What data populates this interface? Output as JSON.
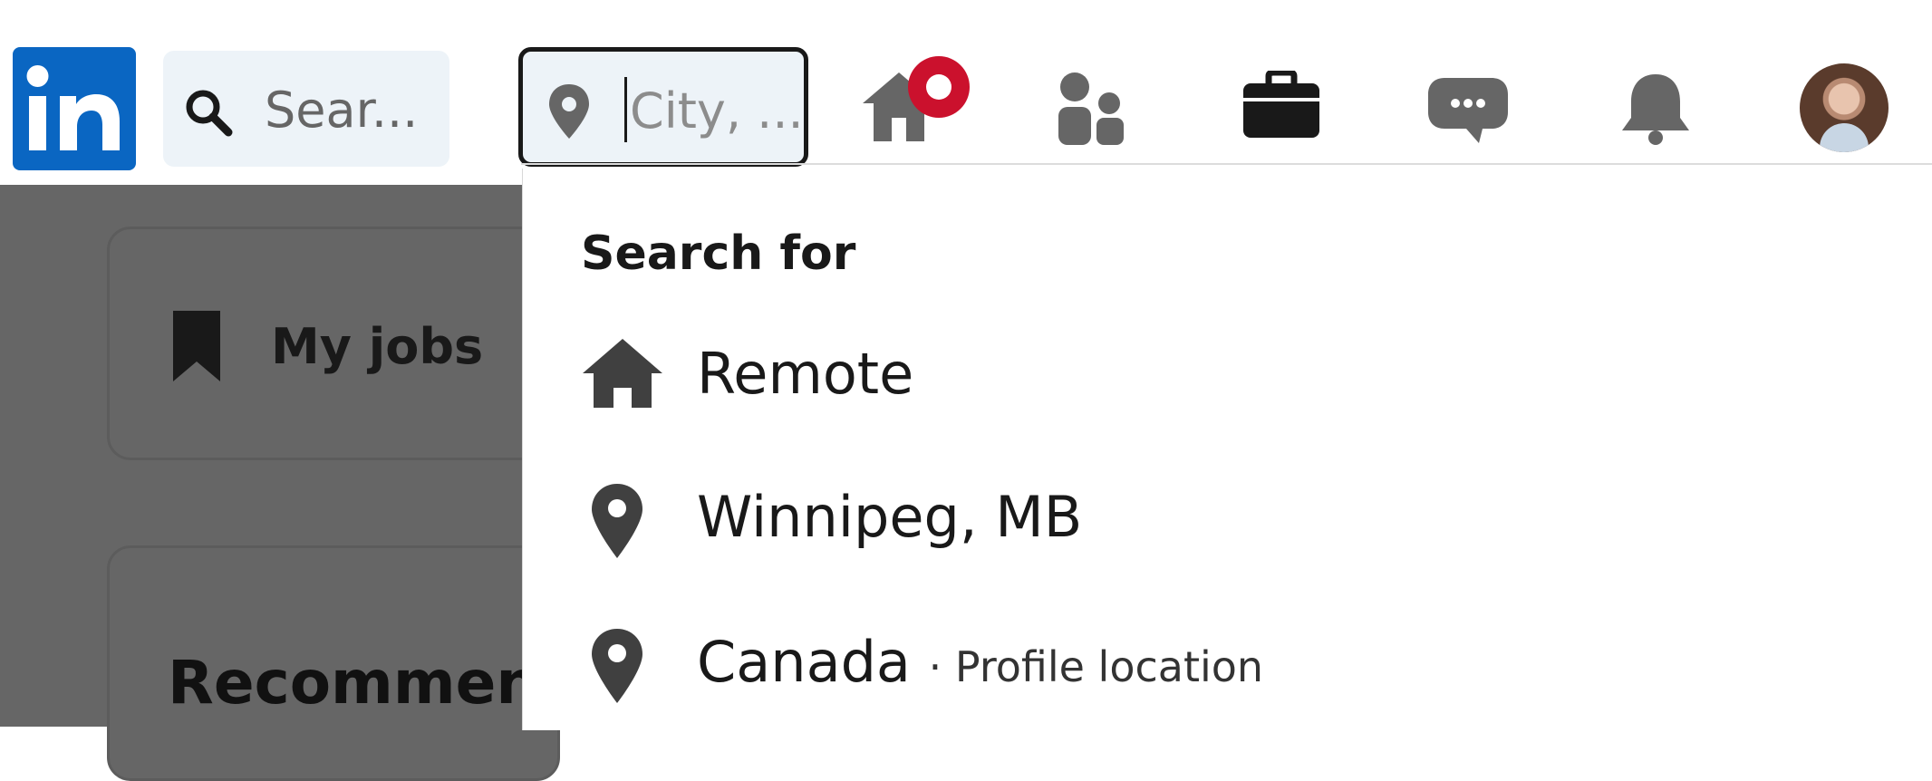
{
  "header": {
    "logo_text": "in",
    "search": {
      "placeholder": "Sear..."
    },
    "location": {
      "placeholder": "City, ..."
    },
    "nav_icons": [
      "home-icon",
      "my-network-icon",
      "jobs-icon",
      "messaging-icon",
      "notifications-icon",
      "profile-avatar"
    ]
  },
  "background": {
    "my_jobs_label": "My jobs",
    "recommended_label": "Recommenc"
  },
  "dropdown": {
    "title": "Search for",
    "options": [
      {
        "icon": "home-icon",
        "label": "Remote",
        "sub": ""
      },
      {
        "icon": "location-pin-icon",
        "label": "Winnipeg, MB",
        "sub": ""
      },
      {
        "icon": "location-pin-icon",
        "label": "Canada",
        "sub": "· Profile location"
      }
    ]
  },
  "colors": {
    "brand": "#0a66c2",
    "badge": "#cb112d",
    "icon_gray": "#666666",
    "overlay": "#666666"
  }
}
